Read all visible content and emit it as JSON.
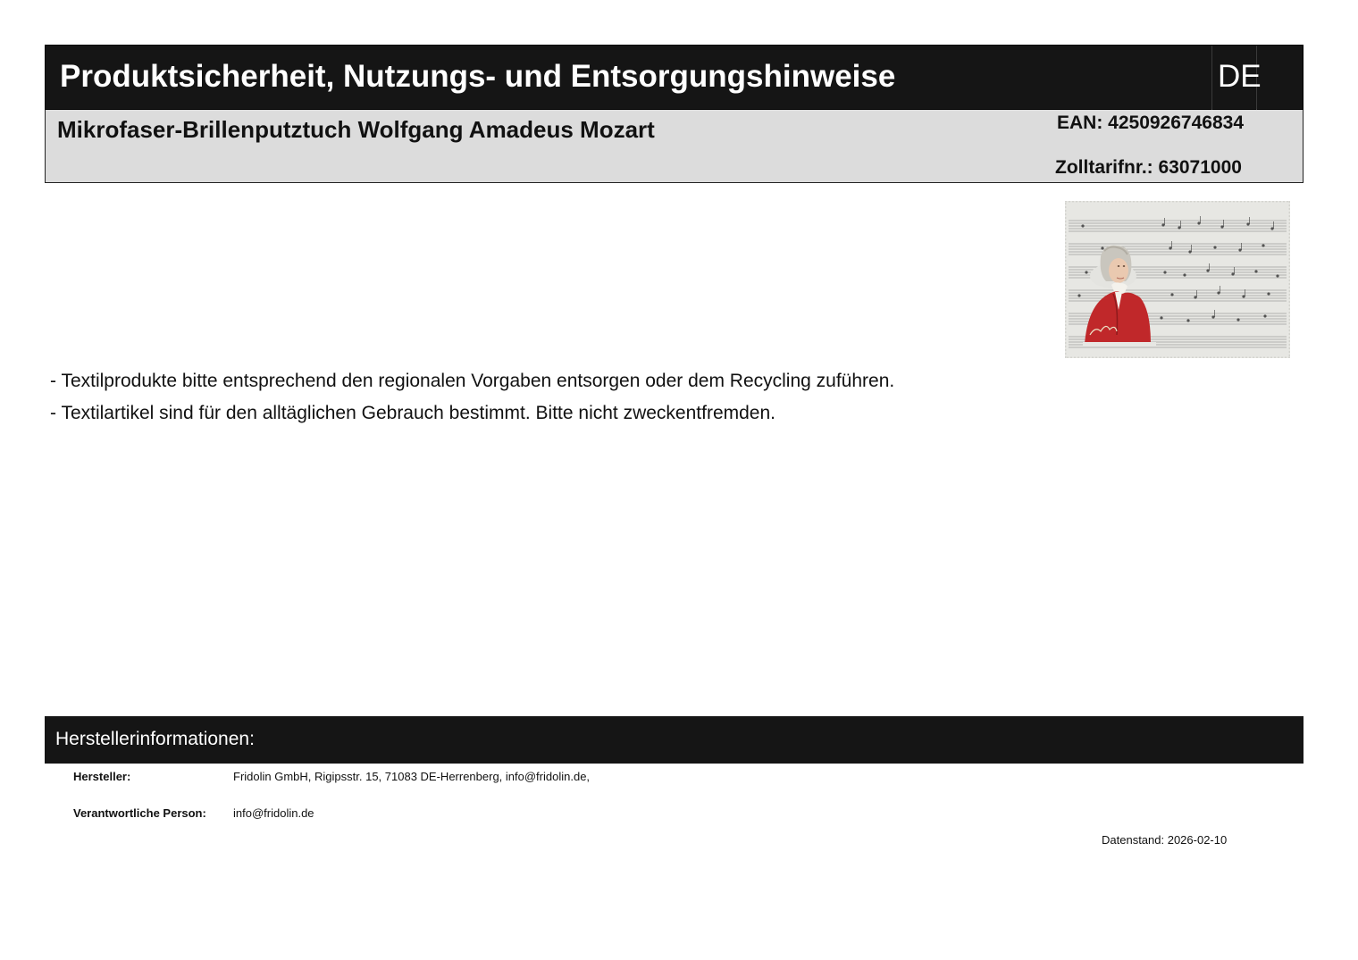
{
  "header": {
    "title": "Produktsicherheit, Nutzungs- und Entsorgungshinweise",
    "language": "DE"
  },
  "product": {
    "name": "Mikrofaser-Brillenputztuch Wolfgang Amadeus Mozart",
    "ean": "EAN: 4250926746834",
    "tariff": "Zolltarifnr.: 63071000"
  },
  "notes": [
    "- Textilprodukte bitte entsprechend den regionalen Vorgaben entsorgen oder dem Recycling zuführen.",
    "- Textilartikel sind für den alltäglichen Gebrauch bestimmt. Bitte nicht zweckentfremden."
  ],
  "manufacturer": {
    "section_title": "Herstellerinformationen:",
    "maker_label": "Hersteller:",
    "maker_value": "Fridolin GmbH, Rigipsstr. 15, 71083 DE-Herrenberg, info@fridolin.de,",
    "responsible_label": "Verantwortliche Person:",
    "responsible_value": "info@fridolin.de"
  },
  "date": "Datenstand: 2026-02-10",
  "colors": {
    "header_bg": "#151515",
    "product_bar_bg": "#dcdcdc",
    "coat_red": "#c0282a"
  }
}
